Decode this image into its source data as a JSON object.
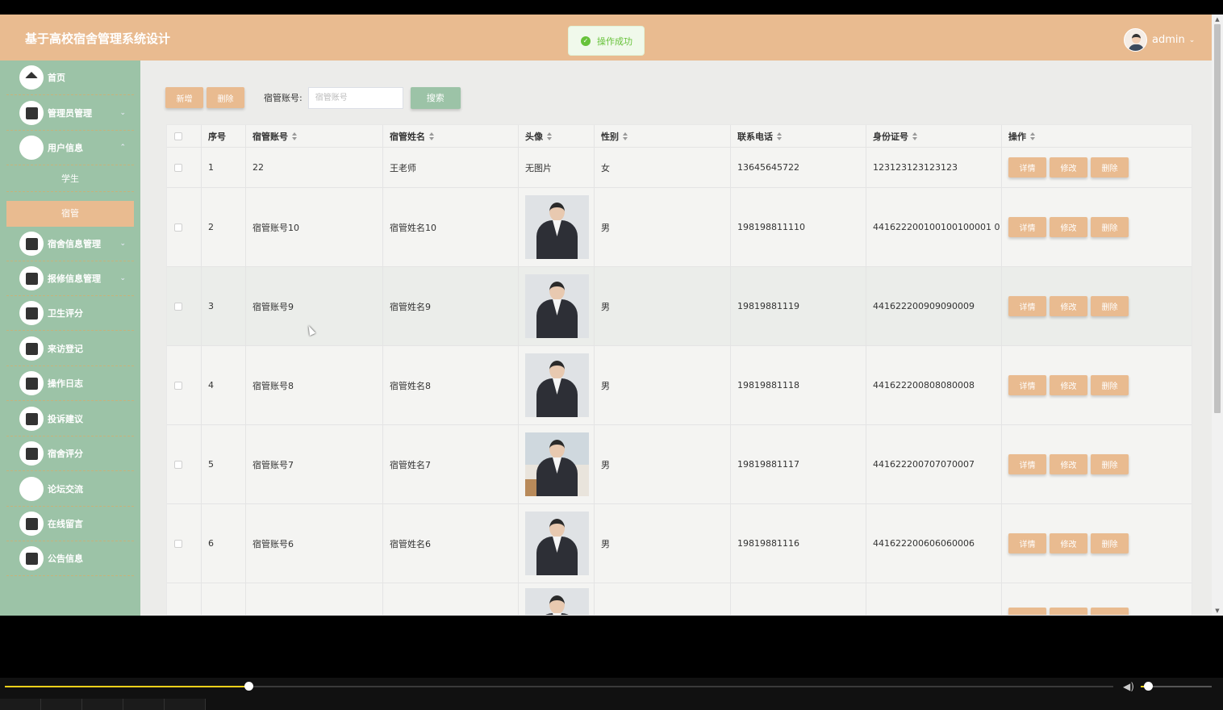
{
  "header": {
    "app_title": "基于高校宿舍管理系统设计",
    "toast": "操作成功",
    "username": "admin"
  },
  "sidebar": {
    "items": [
      {
        "label": "首页",
        "icon": "home-icon"
      },
      {
        "label": "管理员管理",
        "icon": "database-icon",
        "expandable": true
      },
      {
        "label": "用户信息",
        "icon": "user-icon",
        "expandable": true,
        "expanded": true
      },
      {
        "label": "宿舍信息管理",
        "icon": "crop-icon",
        "expandable": true
      },
      {
        "label": "报修信息管理",
        "icon": "storage-icon",
        "expandable": true
      },
      {
        "label": "卫生评分",
        "icon": "panel-icon"
      },
      {
        "label": "来访登记",
        "icon": "square-icon"
      },
      {
        "label": "操作日志",
        "icon": "storage-icon"
      },
      {
        "label": "投诉建议",
        "icon": "panel-icon"
      },
      {
        "label": "宿舍评分",
        "icon": "copy-icon"
      },
      {
        "label": "论坛交流",
        "icon": "blank-icon"
      },
      {
        "label": "在线留言",
        "icon": "resize-icon"
      },
      {
        "label": "公告信息",
        "icon": "archive-icon"
      }
    ],
    "sub_items": [
      {
        "label": "学生",
        "active": false
      },
      {
        "label": "宿管",
        "active": true
      }
    ]
  },
  "toolbar": {
    "add_label": "新增",
    "delete_label": "删除",
    "search_label": "宿管账号:",
    "search_placeholder": "宿管账号",
    "search_button": "搜索"
  },
  "table": {
    "headers": [
      "序号",
      "宿管账号",
      "宿管姓名",
      "头像",
      "性别",
      "联系电话",
      "身份证号",
      "操作"
    ],
    "rows": [
      {
        "index": "1",
        "account": "22",
        "name": "王老师",
        "avatar_text": "无图片",
        "avatar": "none",
        "gender": "女",
        "phone": "13645645722",
        "id_card": "123123123123123"
      },
      {
        "index": "2",
        "account": "宿管账号10",
        "name": "宿管姓名10",
        "avatar": "woman-suit",
        "gender": "男",
        "phone": "198198811110",
        "id_card": "441622200100100100001 0"
      },
      {
        "index": "3",
        "account": "宿管账号9",
        "name": "宿管姓名9",
        "avatar": "man-vest",
        "gender": "男",
        "phone": "19819881119",
        "id_card": "441622200909090009"
      },
      {
        "index": "4",
        "account": "宿管账号8",
        "name": "宿管姓名8",
        "avatar": "woman-suit",
        "gender": "男",
        "phone": "19819881118",
        "id_card": "441622200808080008"
      },
      {
        "index": "5",
        "account": "宿管账号7",
        "name": "宿管姓名7",
        "avatar": "man-office",
        "gender": "男",
        "phone": "19819881117",
        "id_card": "441622200707070007"
      },
      {
        "index": "6",
        "account": "宿管账号6",
        "name": "宿管姓名6",
        "avatar": "woman-suit",
        "gender": "男",
        "phone": "19819881116",
        "id_card": "441622200606060006"
      }
    ],
    "actions": [
      "详情",
      "修改",
      "删除"
    ]
  },
  "player": {
    "progress": 0.22,
    "volume": 0.1
  },
  "colors": {
    "header": "#e9bb90",
    "sidebar": "#9cc3a7",
    "accent_button": "#e9bb90",
    "search_button": "#9cc3a7",
    "toast_text": "#67c23a"
  }
}
